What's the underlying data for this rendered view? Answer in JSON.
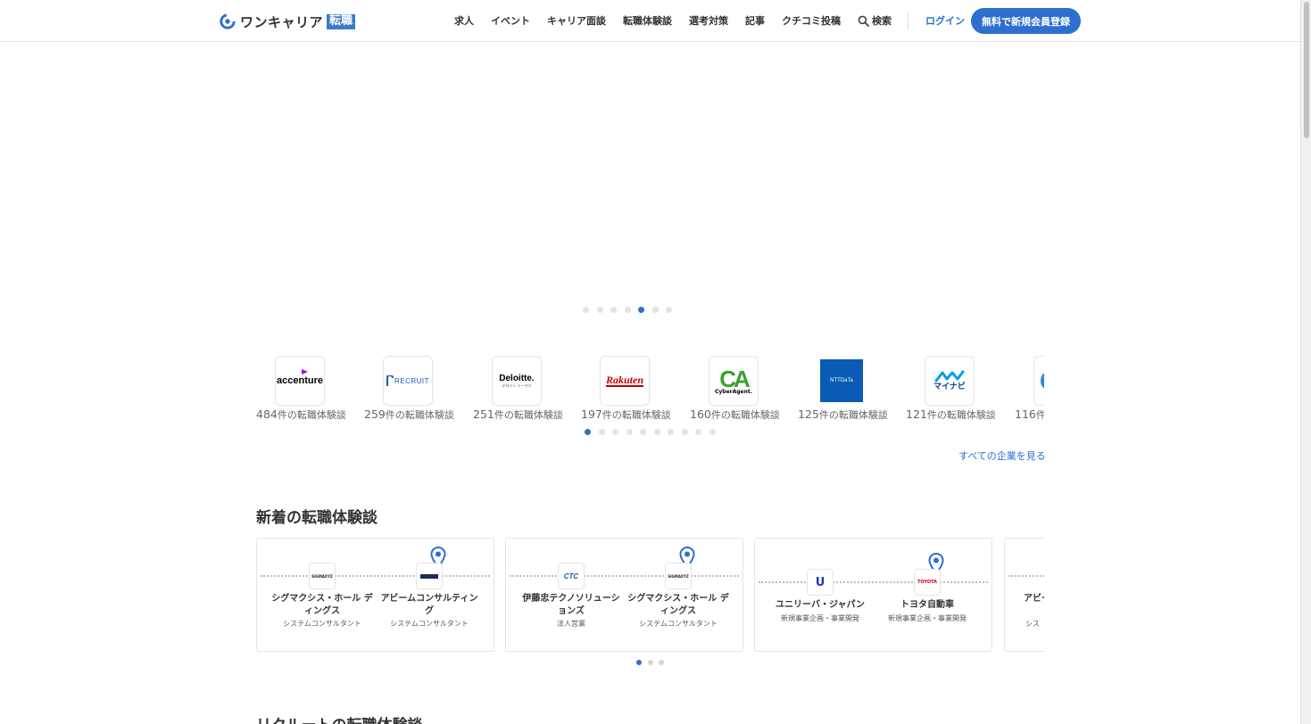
{
  "header": {
    "logo": {
      "brand": "ワンキャリア",
      "tag": "転職"
    },
    "nav": [
      {
        "id": "jobs",
        "label": "求人"
      },
      {
        "id": "events",
        "label": "イベント"
      },
      {
        "id": "career-interview",
        "label": "キャリア面談"
      },
      {
        "id": "stories",
        "label": "転職体験談"
      },
      {
        "id": "selection",
        "label": "選考対策"
      },
      {
        "id": "articles",
        "label": "記事"
      },
      {
        "id": "review-post",
        "label": "クチコミ投稿"
      }
    ],
    "search_label": "検索",
    "login_label": "ログイン",
    "signup_label": "無料で新規会員登録"
  },
  "colors": {
    "accent": "#2c6fcf",
    "dot_inactive": "#e3e3e3"
  },
  "hero": {
    "dots": 7,
    "active_dot": 5
  },
  "companies": {
    "items": [
      {
        "name": "accenture",
        "count": "484",
        "suffix": "件の転職体験談"
      },
      {
        "name": "RECRUIT",
        "count": "259",
        "suffix": "件の転職体験談"
      },
      {
        "name": "Deloitte.",
        "sub": "デロイト トーマツ",
        "count": "251",
        "suffix": "件の転職体験談"
      },
      {
        "name": "Rakuten",
        "count": "197",
        "suffix": "件の転職体験談"
      },
      {
        "name": "CyberAgent.",
        "count": "160",
        "suffix": "件の転職体験談"
      },
      {
        "name": "NTTDaTa",
        "count": "125",
        "suffix": "件の転職体験談"
      },
      {
        "name": "マイナビ",
        "count": "121",
        "suffix": "件の転職体験談"
      },
      {
        "name": "",
        "count": "116",
        "suffix": "件の"
      }
    ],
    "dots": 10,
    "active_dot": 1,
    "see_all": "すべての企業を見る"
  },
  "new_stories": {
    "title": "新着の転職体験談",
    "cards": [
      {
        "from": {
          "name": "シグマクシス・ホール ディングス",
          "role": "システムコンサルタント"
        },
        "to": {
          "name": "アビームコンサルティン グ",
          "role": "システムコンサルタント"
        }
      },
      {
        "from": {
          "name": "伊藤忠テクノソリューシ ョンズ",
          "role": "法人営業",
          "logo": "CTC"
        },
        "to": {
          "name": "シグマクシス・ホール ディングス",
          "role": "システムコンサルタント"
        }
      },
      {
        "from": {
          "name": "ユニリーバ・ジャパン",
          "role": "新規事業企画・事業開発"
        },
        "to": {
          "name": "トヨタ自動車",
          "role": "新規事業企画・事業開発",
          "logo": "TOYOTA"
        }
      },
      {
        "from": {
          "name": "アビー",
          "role": "シス"
        }
      }
    ],
    "dots": 3,
    "active_dot": 1
  },
  "next_section": {
    "title": "リクルートの転職体験談"
  }
}
